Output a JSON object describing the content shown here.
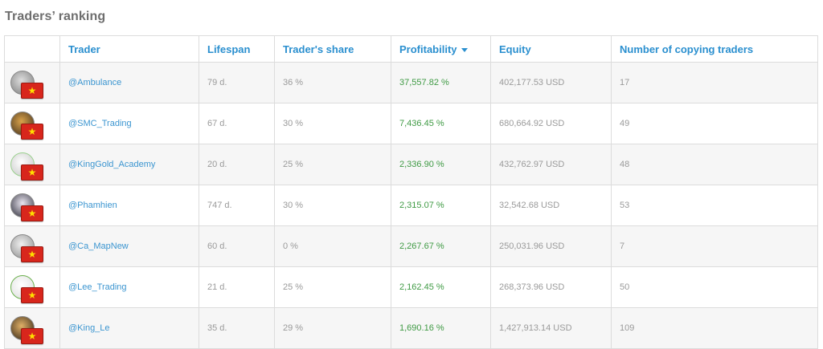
{
  "page": {
    "title": "Traders’ ranking"
  },
  "table": {
    "columns": {
      "trader": "Trader",
      "lifespan": "Lifespan",
      "share": "Trader's share",
      "profitability": "Profitability",
      "equity": "Equity",
      "copying": "Number of copying traders"
    },
    "rows": [
      {
        "trader": "@Ambulance",
        "lifespan": "79 d.",
        "share": "36 %",
        "profitability": "37,557.82 %",
        "equity": "402,177.53 USD",
        "copying": "17"
      },
      {
        "trader": "@SMC_Trading",
        "lifespan": "67 d.",
        "share": "30 %",
        "profitability": "7,436.45 %",
        "equity": "680,664.92 USD",
        "copying": "49"
      },
      {
        "trader": "@KingGold_Academy",
        "lifespan": "20 d.",
        "share": "25 %",
        "profitability": "2,336.90 %",
        "equity": "432,762.97 USD",
        "copying": "48"
      },
      {
        "trader": "@Phamhien",
        "lifespan": "747 d.",
        "share": "30 %",
        "profitability": "2,315.07 %",
        "equity": "32,542.68 USD",
        "copying": "53"
      },
      {
        "trader": "@Ca_MapNew",
        "lifespan": "60 d.",
        "share": "0 %",
        "profitability": "2,267.67 %",
        "equity": "250,031.96 USD",
        "copying": "7"
      },
      {
        "trader": "@Lee_Trading",
        "lifespan": "21 d.",
        "share": "25 %",
        "profitability": "2,162.45 %",
        "equity": "268,373.96 USD",
        "copying": "50"
      },
      {
        "trader": "@King_Le",
        "lifespan": "35 d.",
        "share": "29 %",
        "profitability": "1,690.16 %",
        "equity": "1,427,913.14 USD",
        "copying": "109"
      }
    ],
    "flag_glyph": "★",
    "colors": {
      "link": "#3b95d0",
      "profit": "#3f9a44",
      "flag": "#d8261c"
    }
  }
}
